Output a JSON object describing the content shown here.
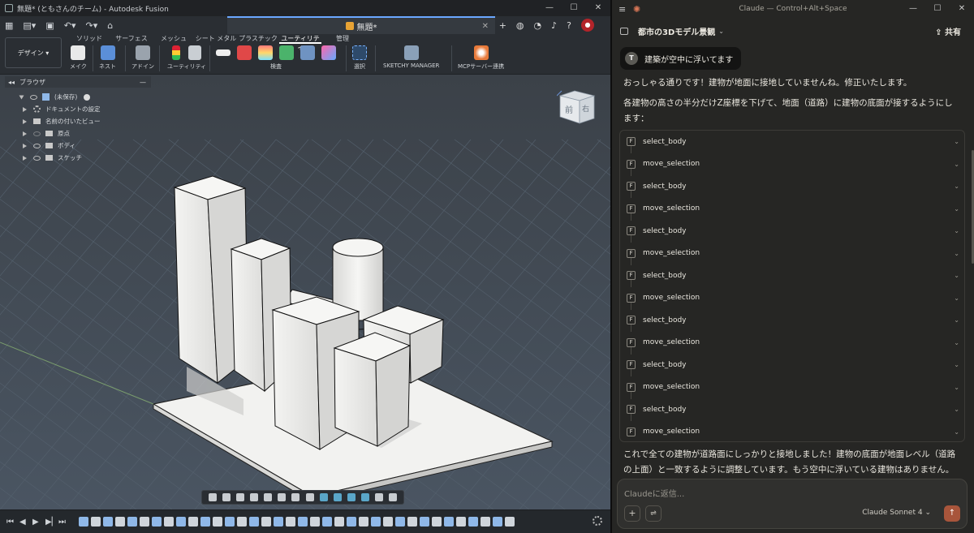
{
  "fusion": {
    "title": "無題* (ともさんのチーム) - Autodesk Fusion",
    "doc_tab": "無題*",
    "design_button": "デザイン",
    "ribbon_tabs": [
      "ソリッド",
      "サーフェス",
      "メッシュ",
      "シート メタル",
      "プラスチック",
      "ユーティリティ",
      "管理"
    ],
    "active_tab_index": 5,
    "ribbon_buttons": [
      {
        "label": "メイク",
        "icon": "make-icon"
      },
      {
        "label": "ネスト",
        "icon": "nest-icon"
      },
      {
        "label": "アドイン",
        "icon": "addin-icon"
      },
      {
        "label": "ユーティリティ",
        "icon": "utility-icon"
      },
      {
        "label": "検査",
        "icon": "inspect-icon"
      },
      {
        "label": "選択",
        "icon": "select-icon"
      },
      {
        "label": "SKETCHY MANAGER",
        "icon": "sketchy-manager-icon"
      },
      {
        "label": "MCPサーバー連携",
        "icon": "mcp-server-icon"
      }
    ],
    "browser": {
      "title": "ブラウザ",
      "items": [
        {
          "label": "(未保存)",
          "icon": "component-icon"
        },
        {
          "label": "ドキュメントの設定",
          "icon": "gear-icon"
        },
        {
          "label": "名前の付いたビュー",
          "icon": "folder-icon"
        },
        {
          "label": "原点",
          "icon": "folder-icon"
        },
        {
          "label": "ボディ",
          "icon": "folder-icon"
        },
        {
          "label": "スケッチ",
          "icon": "folder-icon"
        }
      ]
    },
    "viewcube": {
      "front": "前",
      "right": "右"
    },
    "colors": {
      "accent": "#6aa7ff",
      "grid_bg": "#3a4450",
      "grid_line": "#55616e",
      "model": "#ececea"
    }
  },
  "claude": {
    "window_title": "Claude — Control+Alt+Space",
    "project_title": "都市の3Dモデル景観",
    "share_label": "共有",
    "user_initial": "T",
    "user_message": "建築が空中に浮いてます",
    "response_intro_1": "おっしゃる通りです！建物が地面に接地していませんね。修正いたします。",
    "response_intro_2": "各建物の高さの半分だけZ座標を下げて、地面（道路）に建物の底面が接するようにします：",
    "tool_calls": [
      "select_body",
      "move_selection",
      "select_body",
      "move_selection",
      "select_body",
      "move_selection",
      "select_body",
      "move_selection",
      "select_body",
      "move_selection",
      "select_body",
      "move_selection",
      "select_body",
      "move_selection"
    ],
    "response_outro": "これで全ての建物が道路面にしっかりと接地しました！建物の底面が地面レベル（道路の上面）と一致するように調整しています。もう空中に浮いている建物はありません。",
    "input_placeholder": "Claudeに返信...",
    "model_label": "Claude Sonnet 4",
    "colors": {
      "accent": "#d97757",
      "send_button": "#a8553b"
    }
  }
}
